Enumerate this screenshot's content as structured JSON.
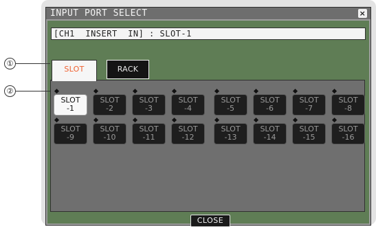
{
  "dialog": {
    "title": "INPUT PORT SELECT",
    "close_icon": "close-x-icon",
    "header_text": "[CH1  INSERT  IN] : SLOT-1"
  },
  "tabs": [
    {
      "label": "SLOT",
      "active": true
    },
    {
      "label": "RACK",
      "active": false
    }
  ],
  "slots": [
    {
      "label": "SLOT\n-1",
      "selected": true
    },
    {
      "label": "SLOT\n-2",
      "selected": false
    },
    {
      "label": "SLOT\n-3",
      "selected": false
    },
    {
      "label": "SLOT\n-4",
      "selected": false
    },
    {
      "label": "SLOT\n-5",
      "selected": false
    },
    {
      "label": "SLOT\n-6",
      "selected": false
    },
    {
      "label": "SLOT\n-7",
      "selected": false
    },
    {
      "label": "SLOT\n-8",
      "selected": false
    },
    {
      "label": "SLOT\n-9",
      "selected": false
    },
    {
      "label": "SLOT\n-10",
      "selected": false
    },
    {
      "label": "SLOT\n-11",
      "selected": false
    },
    {
      "label": "SLOT\n-12",
      "selected": false
    },
    {
      "label": "SLOT\n-13",
      "selected": false
    },
    {
      "label": "SLOT\n-14",
      "selected": false
    },
    {
      "label": "SLOT\n-15",
      "selected": false
    },
    {
      "label": "SLOT\n-16",
      "selected": false
    }
  ],
  "close_button": "CLOSE",
  "callouts": [
    "①",
    "②"
  ],
  "colors": {
    "dialog_green": "#5f7d55",
    "active_tab_text": "#f06030",
    "slot_bg": "#1e1e1e",
    "content_bg": "#6f6f6f"
  }
}
